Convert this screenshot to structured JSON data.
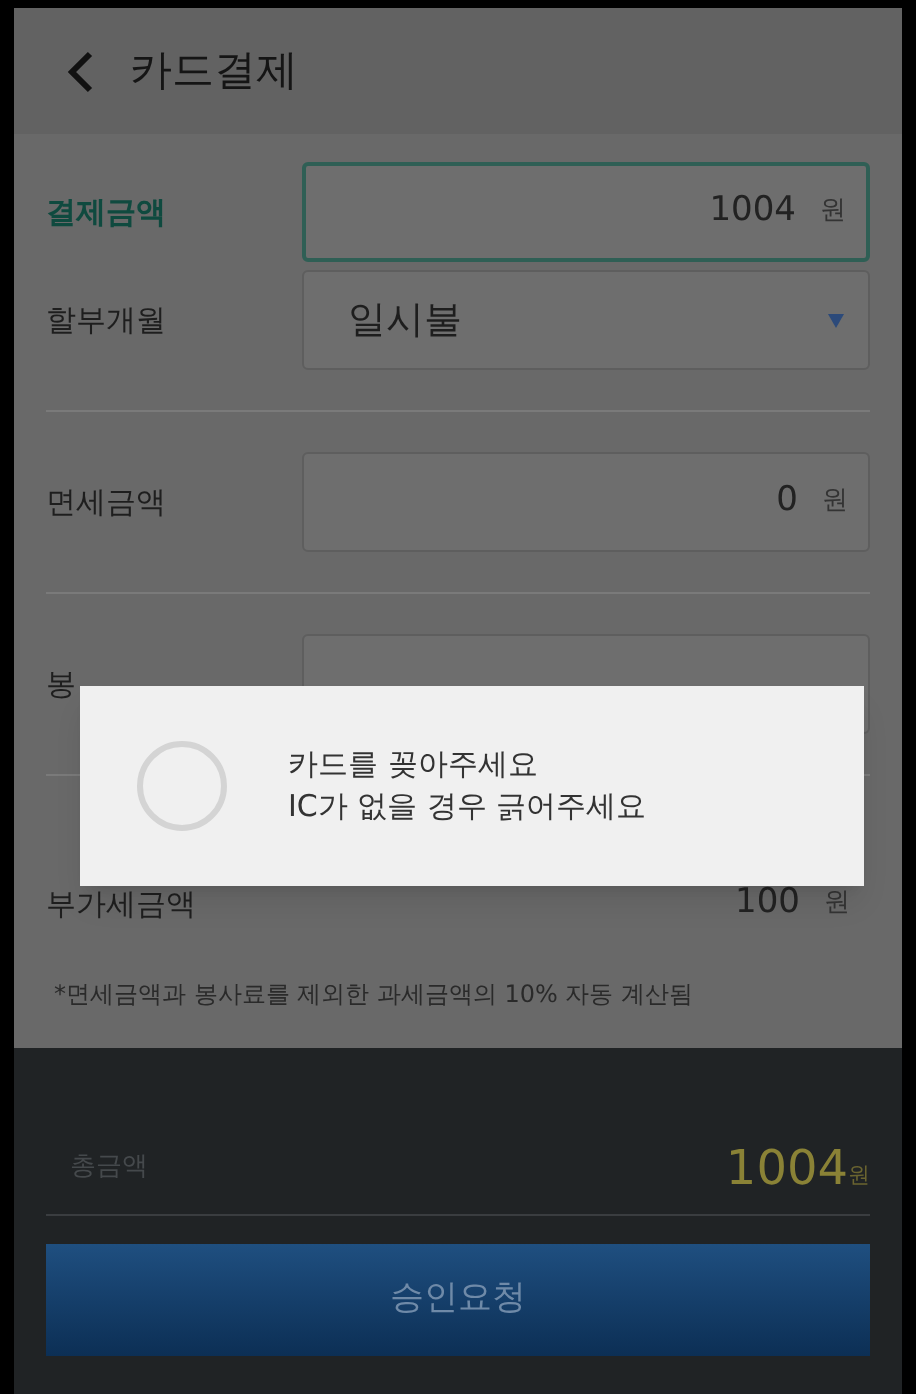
{
  "header": {
    "title": "카드결제"
  },
  "fields": [
    {
      "kind": "amount",
      "label": "결제금액",
      "value": "1004",
      "unit": "원",
      "focused": true
    },
    {
      "kind": "select",
      "label": "할부개월",
      "value": "일시불",
      "focused": false
    },
    {
      "kind": "divider"
    },
    {
      "kind": "amount",
      "label": "면세금액",
      "value": "0",
      "unit": "원",
      "focused": false
    },
    {
      "kind": "divider"
    },
    {
      "kind": "amount",
      "label": "봉",
      "focused": false
    },
    {
      "kind": "divider"
    },
    {
      "kind": "static",
      "label": "부가세금액",
      "value": "100",
      "unit": "원"
    }
  ],
  "note": "*면세금액과 봉사료를 제외한 과세금액의 10% 자동 계산됨",
  "total": {
    "label": "총금액",
    "value": "1004",
    "unit": "원"
  },
  "submit_button": "승인요청",
  "dialog": {
    "lines": [
      "카드를 꽂아주세요",
      "IC가 없을 경우 긁어주세요"
    ]
  }
}
